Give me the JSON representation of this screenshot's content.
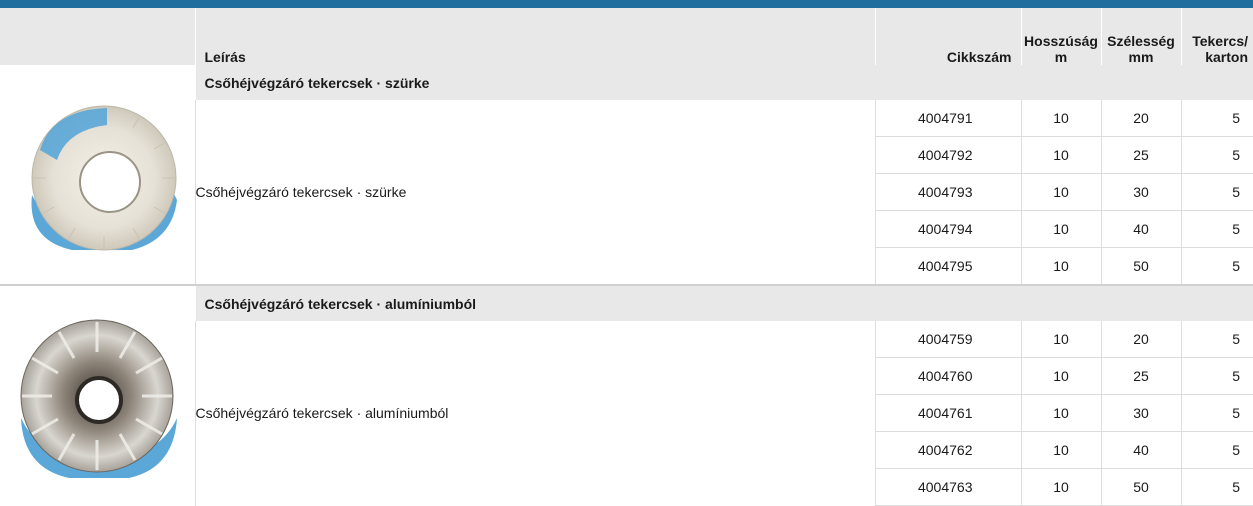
{
  "header": {
    "description": "Leírás",
    "article_no": "Cikkszám",
    "length_line1": "Hosszúság",
    "length_line2": "m",
    "width_line1": "Szélesség",
    "width_line2": "mm",
    "rolls_line1": "Tekercs/",
    "rolls_line2": "karton"
  },
  "groups": [
    {
      "title": "Csőhéjvégzáró tekercsek · szürke",
      "description": "Csőhéjvégzáró tekercsek · szürke",
      "image": "grey-insulation-roll",
      "rows": [
        {
          "article": "4004791",
          "length": "10",
          "width": "20",
          "per_carton": "5"
        },
        {
          "article": "4004792",
          "length": "10",
          "width": "25",
          "per_carton": "5"
        },
        {
          "article": "4004793",
          "length": "10",
          "width": "30",
          "per_carton": "5"
        },
        {
          "article": "4004794",
          "length": "10",
          "width": "40",
          "per_carton": "5"
        },
        {
          "article": "4004795",
          "length": "10",
          "width": "50",
          "per_carton": "5"
        }
      ]
    },
    {
      "title": "Csőhéjvégzáró tekercsek · alumíniumból",
      "description": "Csőhéjvégzáró tekercsek · alumíniumból",
      "image": "aluminium-insulation-roll",
      "rows": [
        {
          "article": "4004759",
          "length": "10",
          "width": "20",
          "per_carton": "5"
        },
        {
          "article": "4004760",
          "length": "10",
          "width": "25",
          "per_carton": "5"
        },
        {
          "article": "4004761",
          "length": "10",
          "width": "30",
          "per_carton": "5"
        },
        {
          "article": "4004762",
          "length": "10",
          "width": "40",
          "per_carton": "5"
        },
        {
          "article": "4004763",
          "length": "10",
          "width": "50",
          "per_carton": "5"
        }
      ]
    }
  ],
  "colors": {
    "accent_bar": "#1f6e9d",
    "header_bg": "#e8e8e8",
    "roll_blue": "#5aa7d8"
  }
}
